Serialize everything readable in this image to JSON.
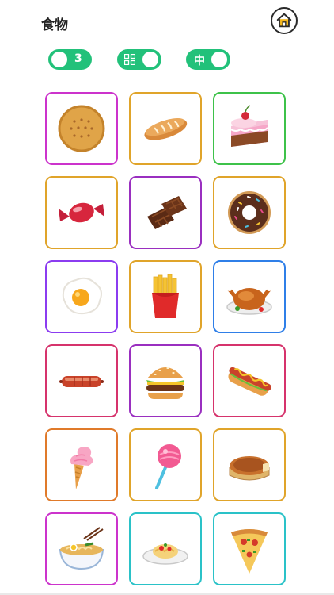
{
  "header": {
    "title": "食物",
    "home_icon": "home-icon"
  },
  "toggles": {
    "count_value": "3",
    "grid_icon": "grid-icon",
    "level_value": "中",
    "color": "#22c17a"
  },
  "cards": [
    {
      "icon": "cookie-icon",
      "border": "#cc33cc"
    },
    {
      "icon": "bread-icon",
      "border": "#e0a42a"
    },
    {
      "icon": "cake-icon",
      "border": "#3ec24a"
    },
    {
      "icon": "candy-icon",
      "border": "#e0a42a"
    },
    {
      "icon": "chocolate-icon",
      "border": "#9a2fc0"
    },
    {
      "icon": "donut-icon",
      "border": "#e0a42a"
    },
    {
      "icon": "fried-egg-icon",
      "border": "#8b3cf0"
    },
    {
      "icon": "french-fries-icon",
      "border": "#e0a42a"
    },
    {
      "icon": "roast-chicken-icon",
      "border": "#2f7fe8"
    },
    {
      "icon": "sausage-icon",
      "border": "#d6336c"
    },
    {
      "icon": "burger-icon",
      "border": "#9a2fc0"
    },
    {
      "icon": "hotdog-icon",
      "border": "#d6336c"
    },
    {
      "icon": "ice-cream-icon",
      "border": "#e07a2a"
    },
    {
      "icon": "lollipop-icon",
      "border": "#e0a42a"
    },
    {
      "icon": "pie-icon",
      "border": "#e0a42a"
    },
    {
      "icon": "ramen-icon",
      "border": "#cc33cc"
    },
    {
      "icon": "spaghetti-icon",
      "border": "#2ac2c8"
    },
    {
      "icon": "pizza-icon",
      "border": "#2ac2c8"
    }
  ]
}
